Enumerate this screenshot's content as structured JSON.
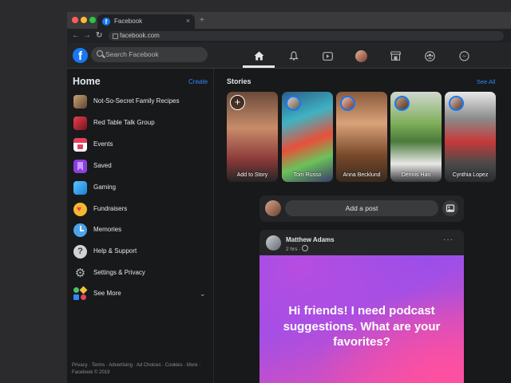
{
  "browser": {
    "tab_title": "Facebook",
    "tab_close": "×",
    "new_tab": "+",
    "url": "facebook.com"
  },
  "topbar": {
    "logo": "f",
    "search_placeholder": "Search Facebook",
    "nav_icons": [
      "home-icon",
      "bell-icon",
      "watch-icon",
      "profile-avatar",
      "marketplace-icon",
      "groups-icon",
      "messenger-icon"
    ]
  },
  "sidebar": {
    "title": "Home",
    "create": "Create",
    "items": [
      {
        "label": "Not-So-Secret Family Recipes",
        "icon": "group-photo-icon",
        "color": "#8a6d4f"
      },
      {
        "label": "Red Table Talk Group",
        "icon": "group-photo-icon",
        "color": "#b3262c"
      },
      {
        "label": "Events",
        "icon": "calendar-icon",
        "color": "#e4415f"
      },
      {
        "label": "Saved",
        "icon": "bookmark-icon",
        "color": "#8b3fe0"
      },
      {
        "label": "Gaming",
        "icon": "gaming-icon",
        "color": "#2aa0e8"
      },
      {
        "label": "Fundraisers",
        "icon": "heart-icon",
        "color": "#f5b82e"
      },
      {
        "label": "Memories",
        "icon": "clock-icon",
        "color": "#4aa6e8"
      },
      {
        "label": "Help & Support",
        "icon": "question-icon",
        "color": "#65676b"
      },
      {
        "label": "Settings & Privacy",
        "icon": "gear-icon",
        "color": "#8a8d91"
      },
      {
        "label": "See More",
        "icon": "shapes-icon",
        "color": "#4cbf6b"
      }
    ],
    "footer": "Privacy · Terms · Advertising · Ad Choices · Cookies · More · Facebook © 2019"
  },
  "stories": {
    "title": "Stories",
    "see_all": "See All",
    "cards": [
      {
        "name": "Add to Story"
      },
      {
        "name": "Tom Russo"
      },
      {
        "name": "Anna Becklund"
      },
      {
        "name": "Dennis Han"
      },
      {
        "name": "Cynthia Lopez"
      }
    ]
  },
  "composer": {
    "label": "Add a post"
  },
  "post": {
    "author": "Matthew Adams",
    "time": "2 hrs · ",
    "menu": "···",
    "text": "Hi friends! I need podcast suggestions. What are your favorites?"
  },
  "colors": {
    "accent": "#1877f2",
    "link": "#2d88ff",
    "surface": "#242526",
    "background": "#18191a"
  }
}
